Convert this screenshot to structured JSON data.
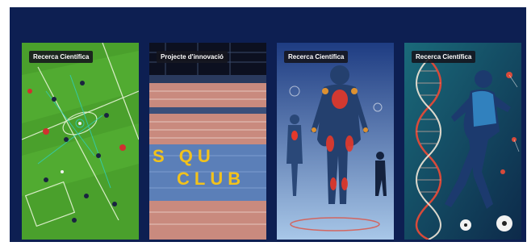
{
  "cards": [
    {
      "badge": "Recerca Científica",
      "image": "football-tactics-field-image"
    },
    {
      "badge": "Projecte d'innovació",
      "image": "stadium-seats-image"
    },
    {
      "badge": "Recerca Científica",
      "image": "anatomy-muscle-figures-image"
    },
    {
      "badge": "Recerca Científica",
      "image": "player-dna-helix-image"
    }
  ],
  "stadium_text": {
    "row1": "S QU",
    "row2": "CLUB"
  },
  "colors": {
    "panel_bg": "#0d1f52",
    "badge_bg": "#14141c",
    "field_green": "#4aa02c",
    "stadium_seats": "#c98a7e",
    "stadium_yellow": "#f2c21b"
  }
}
